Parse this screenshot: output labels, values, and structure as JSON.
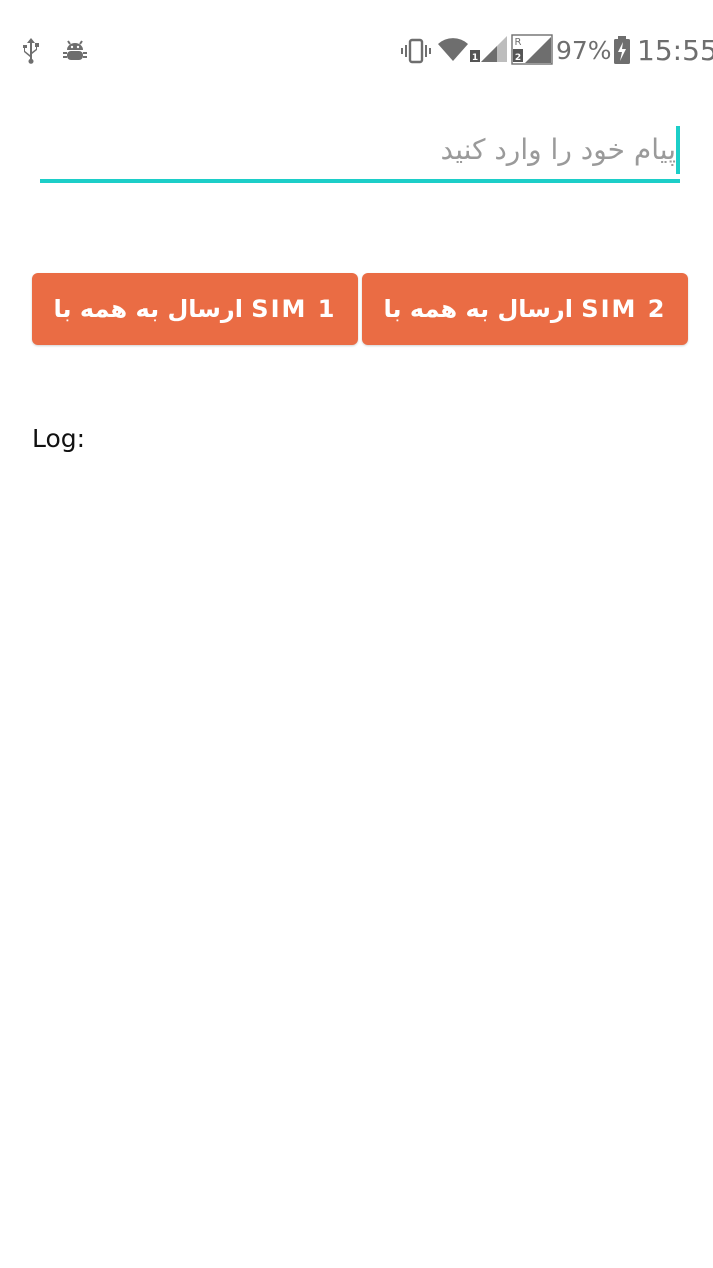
{
  "status_bar": {
    "battery_percent": "97%",
    "time": "15:55",
    "sim1_badge": "1",
    "sim2_badge": "2",
    "roaming_badge": "R",
    "icons": [
      "usb-icon",
      "android-debug-icon",
      "vibrate-icon",
      "wifi-icon",
      "signal-sim1-icon",
      "signal-sim2-icon",
      "battery-charging-icon"
    ]
  },
  "message": {
    "placeholder": "پیام خود را وارد کنید",
    "value": ""
  },
  "buttons": {
    "send_sim1": "ارسال به همه با SIM 1",
    "send_sim2": "ارسال به همه با SIM 2"
  },
  "log": {
    "label": "Log:"
  },
  "colors": {
    "accent": "#1ccec8",
    "button": "#ea6c44",
    "status_icons": "#6e6e6e"
  }
}
